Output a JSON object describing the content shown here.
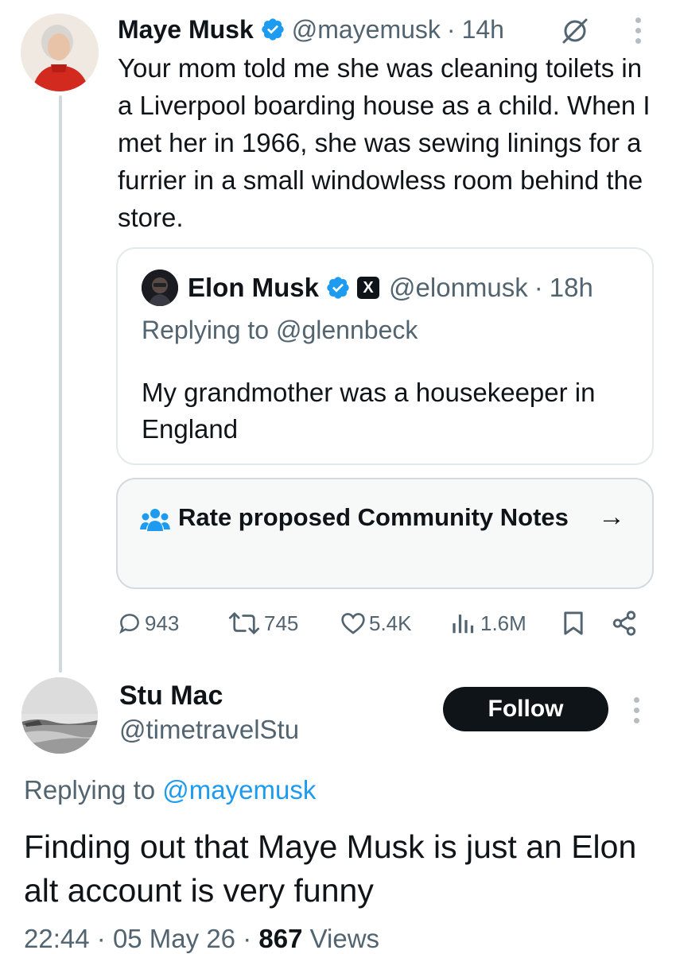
{
  "colors": {
    "text": "#0f1419",
    "secondary": "#536471",
    "link": "#1d9bf0",
    "verified": "#1d9bf0",
    "follow_bg": "#0f1419"
  },
  "tweet": {
    "author_name": "Maye Musk",
    "author_handle": "@mayemusk",
    "time": "14h",
    "text": "Your mom told me she was cleaning toilets in a Liverpool boarding house as a child. When I met her in 1966, she was sewing linings for a furrier in a small windowless room behind the store.",
    "quote": {
      "author_name": "Elon Musk",
      "author_handle": "@elonmusk",
      "time": "18h",
      "x_badge": "X",
      "replying_label": "Replying to @glennbeck",
      "text": "My grandmother was a housekeeper in England"
    },
    "community_notes": {
      "label": "Rate proposed Community Notes",
      "arrow": "→"
    },
    "actions": {
      "replies": "943",
      "reposts": "745",
      "likes": "5.4K",
      "views": "1.6M"
    }
  },
  "reply": {
    "author_name": "Stu Mac",
    "author_handle": "@timetravelStu",
    "follow_label": "Follow",
    "replying_prefix": "Replying to",
    "replying_mention": "@mayemusk",
    "text": "Finding out that Maye Musk is just an Elon alt account is very funny",
    "time": "22:44",
    "date": "05 May 26",
    "views_count": "867",
    "views_label": "Views"
  },
  "separator": "·",
  "icons": [
    "verified-icon",
    "grok-icon",
    "more-icon",
    "x-logo-icon",
    "community-notes-icon",
    "arrow-right-icon",
    "reply-icon",
    "repost-icon",
    "like-icon",
    "views-icon",
    "bookmark-icon",
    "share-icon"
  ]
}
